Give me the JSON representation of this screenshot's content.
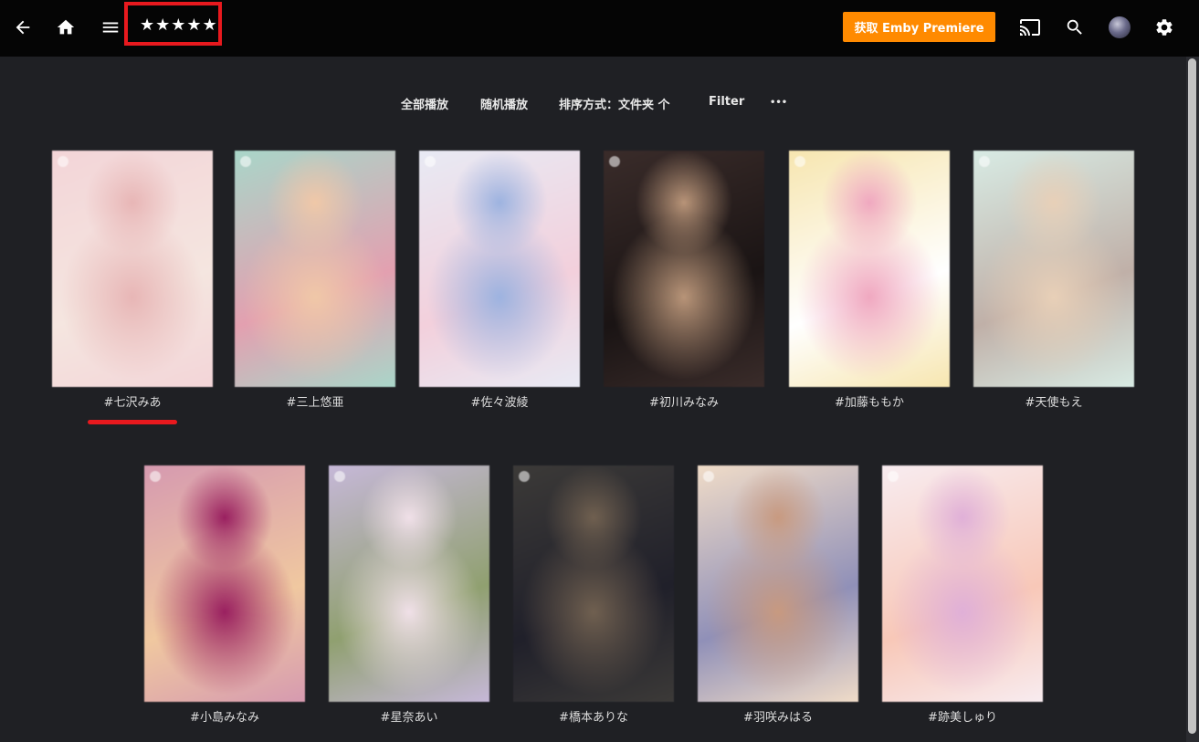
{
  "header": {
    "title": "★★★★★",
    "premiere_label": "获取 Emby Premiere",
    "icons": [
      "back-arrow-icon",
      "home-icon",
      "menu-icon",
      "cast-icon",
      "search-icon",
      "avatar",
      "settings-gear-icon"
    ]
  },
  "toolbar": {
    "play_all": "全部播放",
    "shuffle": "随机播放",
    "sort": "排序方式：文件夹 个",
    "filter": "Filter",
    "more": "•••"
  },
  "items": [
    {
      "label": "#七沢みあ",
      "colors": [
        "#f3d5d8",
        "#e8b6b6",
        "#f5e6e0"
      ]
    },
    {
      "label": "#三上悠亜",
      "colors": [
        "#a9d6c9",
        "#f0c8a8",
        "#e3a0b0"
      ]
    },
    {
      "label": "#佐々波綾",
      "colors": [
        "#e8eaf4",
        "#9db3e0",
        "#f3d0dc"
      ]
    },
    {
      "label": "#初川みなみ",
      "colors": [
        "#3a2c2a",
        "#b89478",
        "#1a1414"
      ]
    },
    {
      "label": "#加藤ももか",
      "colors": [
        "#f7e6b0",
        "#f0a8c0",
        "#ffffff"
      ]
    },
    {
      "label": "#天使もえ",
      "colors": [
        "#d8ebe4",
        "#e8d0b8",
        "#c0b0a8"
      ]
    },
    {
      "label": "#小島みなみ",
      "colors": [
        "#d69ab0",
        "#9a2060",
        "#f0c8a0"
      ]
    },
    {
      "label": "#星奈あい",
      "colors": [
        "#c6b8d8",
        "#f0e0e8",
        "#90a070"
      ]
    },
    {
      "label": "#橋本ありな",
      "colors": [
        "#3c3a38",
        "#706050",
        "#20202a"
      ]
    },
    {
      "label": "#羽咲みはる",
      "colors": [
        "#f0dcc8",
        "#c89a80",
        "#9090b8"
      ]
    },
    {
      "label": "#跡美しゅり",
      "colors": [
        "#f8ecf0",
        "#e0b0d8",
        "#f8c8b8"
      ]
    }
  ],
  "highlight": {
    "title_box_color": "#e8191e",
    "underline_color": "#e8191e"
  },
  "accent": "#ff8a00"
}
